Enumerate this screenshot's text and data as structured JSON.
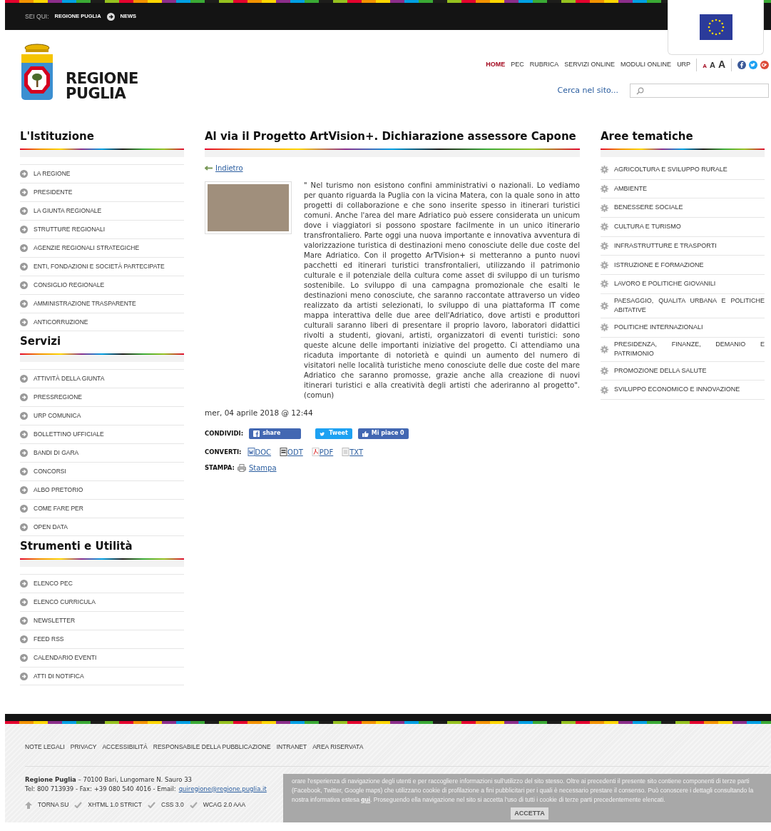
{
  "breadcrumb": {
    "label": "SEI QUI:",
    "items": [
      "REGIONE PUGLIA",
      "NEWS"
    ]
  },
  "logo": {
    "lines": [
      "REGIONE",
      "PUGLIA"
    ]
  },
  "top_nav": [
    {
      "label": "HOME",
      "selected": true
    },
    {
      "label": "PEC",
      "selected": false
    },
    {
      "label": "RUBRICA",
      "selected": false
    },
    {
      "label": "SERVIZI ONLINE",
      "selected": false
    },
    {
      "label": "MODULI ONLINE",
      "selected": false
    },
    {
      "label": "URP",
      "selected": false
    }
  ],
  "font_size_buttons": [
    "A",
    "A",
    "A"
  ],
  "social": [
    {
      "kind": "facebook",
      "color": "#3b5998"
    },
    {
      "kind": "twitter",
      "color": "#1da1f2"
    },
    {
      "kind": "google",
      "color": "#dd4b39"
    }
  ],
  "search": {
    "label": "Cerca nel sito..."
  },
  "left_sections": [
    {
      "title": "L'Istituzione",
      "items": [
        "LA REGIONE",
        "PRESIDENTE",
        "LA GIUNTA REGIONALE",
        "STRUTTURE REGIONALI",
        "AGENZIE REGIONALI STRATEGICHE",
        "ENTI, FONDAZIONI E SOCIETÀ PARTECIPATE",
        "CONSIGLIO REGIONALE",
        "AMMINISTRAZIONE TRASPARENTE",
        "ANTICORRUZIONE"
      ]
    },
    {
      "title": "Servizi",
      "items": [
        "ATTIVITÀ DELLA GIUNTA",
        "PRESSREGIONE",
        "URP COMUNICA",
        "BOLLETTINO UFFICIALE",
        "BANDI DI GARA",
        "CONCORSI",
        "ALBO PRETORIO",
        "COME FARE PER",
        "OPEN DATA"
      ]
    },
    {
      "title": "Strumenti e Utilità",
      "items": [
        "ELENCO PEC",
        "ELENCO CURRICULA",
        "NEWSLETTER",
        "FEED RSS",
        "CALENDARIO EVENTI",
        "ATTI DI NOTIFICA"
      ]
    }
  ],
  "article": {
    "title": "Al via il Progetto ArtVision+. Dichiarazione assessore Capone",
    "back_link": "Indietro",
    "body": "\" Nel turismo non esistono confini amministrativi o nazionali. Lo vediamo per quanto riguarda la Puglia con la vicina Matera, con la quale sono in atto progetti di collaborazione e che sono inserite spesso in itinerari turistici comuni.  Anche l'area del mare Adriatico può essere considerata un unicum dove i viaggiatori si possono spostare facilmente in un unico itinerario transfrontaliero.  Parte oggi una nuova importante e innovativa  avventura  di valorizzazione turistica di destinazioni meno conosciute delle due coste del Mare Adriatico. Con il progetto ArTVision+ si metteranno a punto nuovi pacchetti ed itinerari turistici transfrontalieri, utilizzando il patrimonio culturale e il potenziale della cultura come asset di sviluppo di un turismo sostenibile. Lo sviluppo di una campagna promozionale che esalti le destinazioni meno conosciute, che saranno raccontate attraverso un video realizzato da artisti selezionati, lo sviluppo di  una piattaforma IT come mappa interattiva delle due aree dell'Adriatico, dove artisti e produttori culturali saranno liberi di presentare il proprio lavoro, laboratori didattici rivolti a studenti, giovani, artisti, organizzatori di eventi turistici:  sono  queste alcune delle importanti iniziative del progetto. Ci attendiamo una ricaduta importante di notorietà e quindi un aumento del numero di visitatori nelle località turistiche meno conosciute delle due coste del mare Adriatico che saranno promosse,  grazie anche alla creazione di nuovi itinerari turistici e alla creatività degli artisti che aderiranno al progetto\".(comun)",
    "date": "mer, 04 aprile 2018 @ 12:44",
    "share": {
      "label": "CONDIVIDI:",
      "buttons": [
        {
          "kind": "facebook",
          "label": "share"
        },
        {
          "kind": "twitter",
          "label": "Tweet"
        },
        {
          "kind": "like",
          "label": "Mi piace 0"
        }
      ]
    },
    "convert": {
      "label": "CONVERTI:",
      "links": [
        {
          "kind": "doc",
          "label": "DOC"
        },
        {
          "kind": "odt",
          "label": "ODT"
        },
        {
          "kind": "pdf",
          "label": "PDF"
        },
        {
          "kind": "txt",
          "label": "TXT"
        }
      ]
    },
    "print": {
      "label": "STAMPA:",
      "link": "Stampa"
    }
  },
  "right_section": {
    "title": "Aree tematiche",
    "items": [
      "AGRICOLTURA E SVILUPPO RURALE",
      "AMBIENTE",
      "BENESSERE SOCIALE",
      "CULTURA E TURISMO",
      "INFRASTRUTTURE E TRASPORTI",
      "ISTRUZIONE E FORMAZIONE",
      "LAVORO E POLITICHE GIOVANILI",
      "PAESAGGIO, QUALITA URBANA E POLITICHE ABITATIVE",
      "POLITICHE INTERNAZIONALI",
      "PRESIDENZA, FINANZE, DEMANIO E PATRIMONIO",
      "PROMOZIONE DELLA SALUTE",
      "SVILUPPO ECONOMICO E INNOVAZIONE"
    ]
  },
  "footer": {
    "links": [
      "NOTE LEGALI",
      "PRIVACY",
      "ACCESSIBILITÁ",
      "RESPONSABILE DELLA PUBBLICAZIONE",
      "INTRANET",
      "AREA RISERVATA"
    ],
    "address": "**Regione Puglia** – 70100 Bari, Lungomare N. Sauro 33",
    "contact": "Tel: 800 713939 - Fax: +39 080 540 4016 - Email:",
    "email": "quiregione@regione.puglia.it",
    "badges": [
      {
        "kind": "up",
        "label": "TORNA SU"
      },
      {
        "kind": "check",
        "label": "XHTML 1.0 STRICT"
      },
      {
        "kind": "check",
        "label": "CSS 3.0"
      },
      {
        "kind": "check",
        "label": "WCAG 2.0 AAA"
      }
    ]
  },
  "cookie_banner": {
    "text": "orare l'esperienza di navigazione degli utenti e per raccogliere informazioni sull'utilizzo del sito stesso. Oltre ai precedenti il presente sito contiene componenti di terze parti (Facebook, Twitter, Google maps) che utilizzano cookie di profilazione a fini pubblicitari per i quali è necessario prestare il consenso. Può conoscere i dettagli consultando la nostra informativa estesa",
    "link": "qui",
    "text_after": ". Proseguendo ella navigazione nel sito si accetta l'uso di tutti i cookie di terze parti precedentemente elencati.",
    "button": "ACCETTA"
  }
}
